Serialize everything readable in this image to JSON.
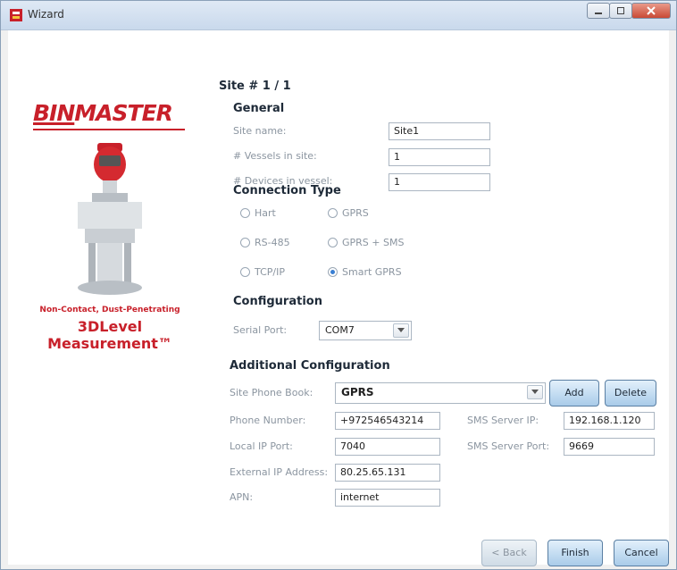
{
  "window": {
    "title": "Wizard"
  },
  "brand": {
    "logo_a": "BIN",
    "logo_b": "MASTER",
    "tagline_small": "Non-Contact, Dust-Penetrating",
    "tagline_large": "3DLevel Measurement™"
  },
  "site_header": "Site # 1 / 1",
  "general": {
    "title": "General",
    "site_name_label": "Site name:",
    "site_name_value": "Site1",
    "vessels_label": "# Vessels in site:",
    "vessels_value": "1",
    "devices_label": "# Devices in vessel:",
    "devices_value": "1"
  },
  "connection": {
    "title": "Connection Type",
    "options": [
      "Hart",
      "GPRS",
      "RS-485",
      "GPRS + SMS",
      "TCP/IP",
      "Smart GPRS"
    ],
    "selected": "Smart GPRS"
  },
  "configuration": {
    "title": "Configuration",
    "serial_port_label": "Serial Port:",
    "serial_port_value": "COM7"
  },
  "additional": {
    "title": "Additional Configuration",
    "phone_book_label": "Site Phone Book:",
    "phone_book_value": "GPRS",
    "add_label": "Add",
    "delete_label": "Delete",
    "phone_label": "Phone Number:",
    "phone_value": "+972546543214",
    "local_port_label": "Local IP Port:",
    "local_port_value": "7040",
    "external_ip_label": "External IP Address:",
    "external_ip_value": "80.25.65.131",
    "apn_label": "APN:",
    "apn_value": "internet",
    "sms_ip_label": "SMS Server IP:",
    "sms_ip_value": "192.168.1.120",
    "sms_port_label": "SMS Server Port:",
    "sms_port_value": "9669"
  },
  "footer": {
    "back_label": "< Back",
    "finish_label": "Finish",
    "cancel_label": "Cancel"
  },
  "colors": {
    "brand_red": "#c8202a",
    "radio_selected": "#3a7fd3"
  }
}
